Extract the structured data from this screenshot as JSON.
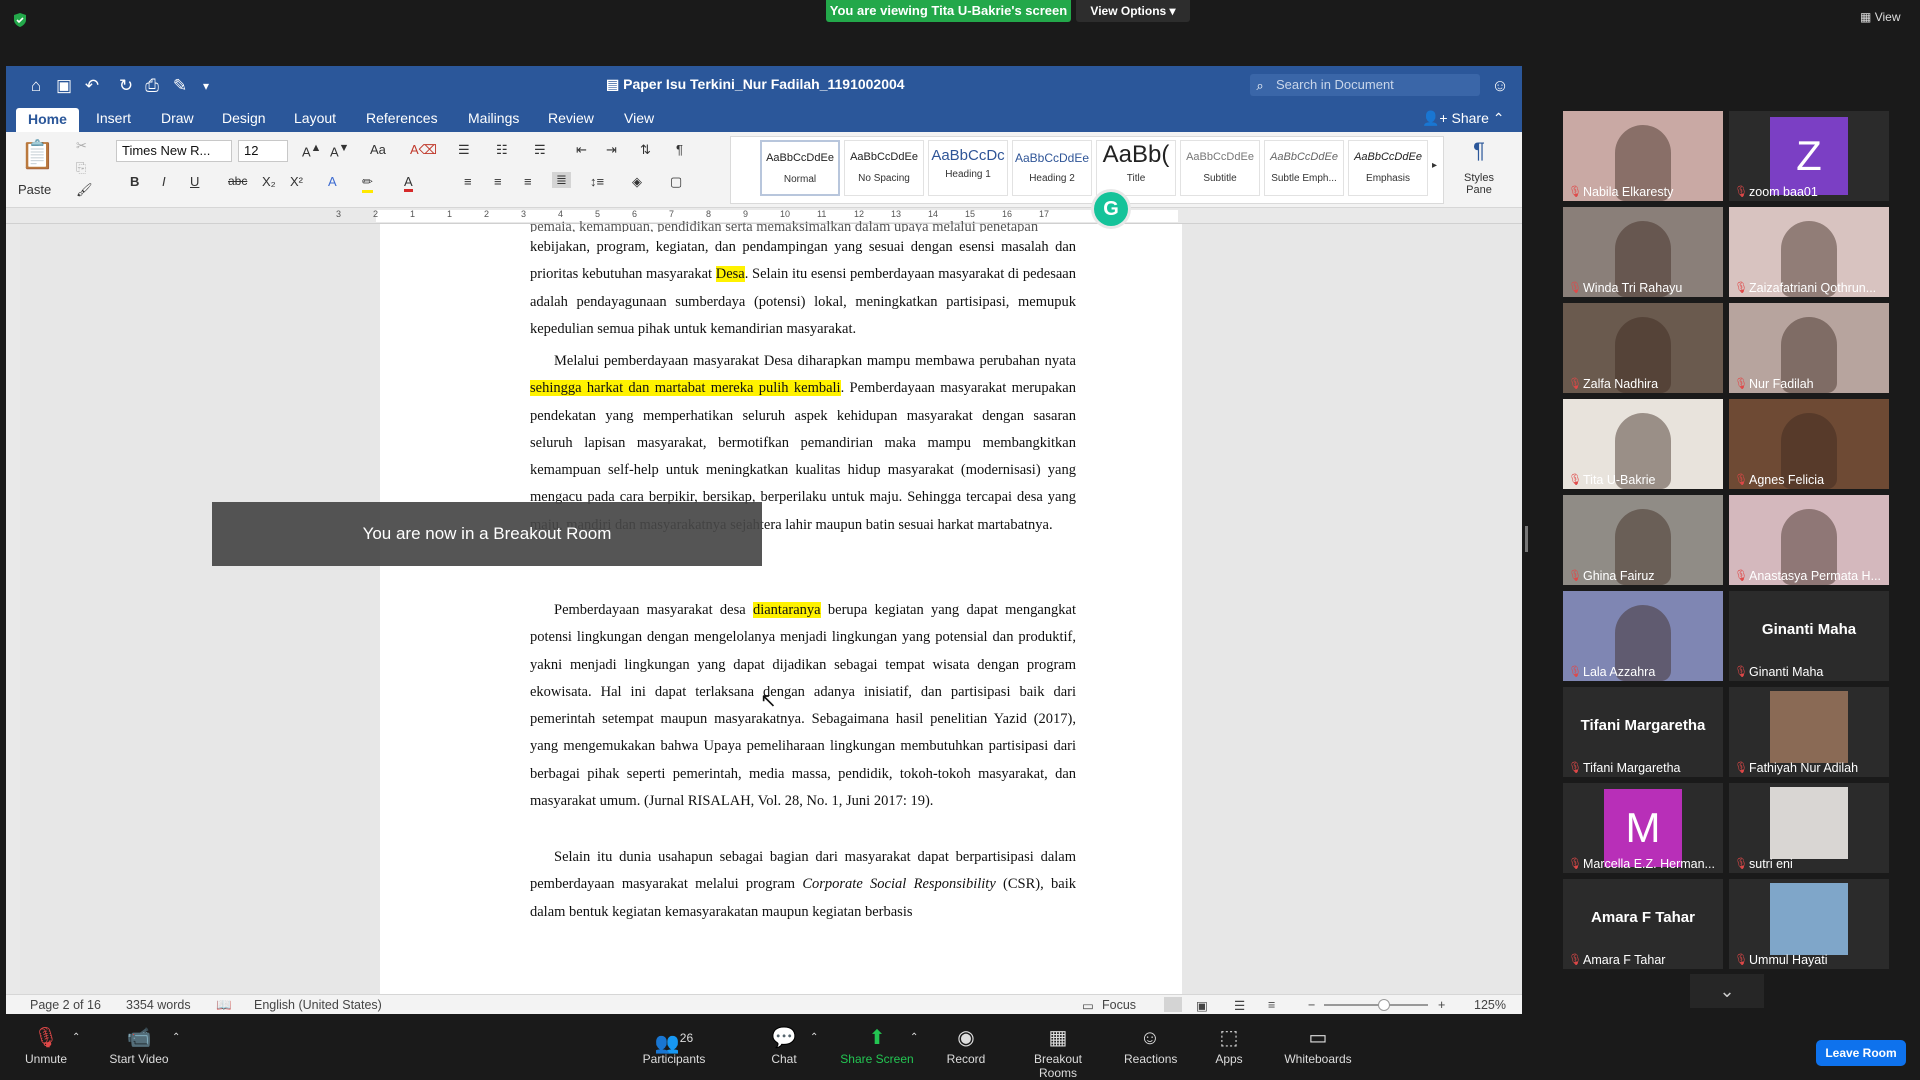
{
  "zoom_top": {
    "banner": "You are viewing Tita U-Bakrie's screen",
    "view_options": "View Options",
    "view": "View"
  },
  "word": {
    "doc_title": "Paper Isu Terkini_Nur Fadilah_1191002004",
    "search_placeholder": "Search in Document",
    "tabs": [
      "Home",
      "Insert",
      "Draw",
      "Design",
      "Layout",
      "References",
      "Mailings",
      "Review",
      "View"
    ],
    "share": "Share",
    "ribbon": {
      "paste": "Paste",
      "font": "Times New R...",
      "size": "12",
      "bold": "B",
      "italic": "I",
      "underline": "U",
      "strike": "abc",
      "sub": "X₂",
      "sup": "X²",
      "styles_pane": "Styles Pane",
      "styles": [
        {
          "sample": "AaBbCcDdEe",
          "name": "Normal"
        },
        {
          "sample": "AaBbCcDdEe",
          "name": "No Spacing"
        },
        {
          "sample": "AaBbCcDc",
          "name": "Heading 1"
        },
        {
          "sample": "AaBbCcDdEe",
          "name": "Heading 2"
        },
        {
          "sample": "AaBb(",
          "name": "Title"
        },
        {
          "sample": "AaBbCcDdEe",
          "name": "Subtitle"
        },
        {
          "sample": "AaBbCcDdEe",
          "name": "Subtle Emph..."
        },
        {
          "sample": "AaBbCcDdEe",
          "name": "Emphasis"
        }
      ]
    },
    "ruler_numbers": [
      "3",
      "2",
      "1",
      "1",
      "2",
      "3",
      "4",
      "5",
      "6",
      "7",
      "8",
      "9",
      "10",
      "11",
      "12",
      "13",
      "14",
      "15",
      "16",
      "17"
    ],
    "doc": {
      "p0_top": "pemaia, kemampuan, pendidikan serta memaksimalkan dalam upaya melalui penetapan",
      "p0": [
        "kebijakan, program, kegiatan, dan  pendampingan yang sesuai dengan esensi masalah",
        "dan prioritas kebutuhan masyarakat ",
        "Desa",
        ". Selain itu esensi pemberdayaan masyarakat di pedesaan adalah pendayagunaan sumberdaya (potensi) lokal, meningkatkan partisipasi, memupuk kepedulian semua pihak untuk kemandirian masyarakat."
      ],
      "p1_a": "Melalui pemberdayaan masyarakat Desa diharapkan mampu membawa perubahan nyata ",
      "p1_hl": "sehingga harkat dan martabat mereka pulih kembali",
      "p1_b": ". Pemberdayaan masyarakat merupakan pendekatan yang memperhatikan seluruh aspek kehidupan masyarakat dengan sasaran seluruh lapisan masyarakat, bermotifkan pemandirian maka mampu membangkitkan kemampuan self-help untuk meningkatkan kualitas hidup masyarakat (modernisasi) yang mengacu pada cara berpikir, bersikap, berperilaku untuk maju. Sehingga tercapai desa yang maju, mandiri dan masyarakatnya sejahtera lahir maupun batin sesuai harkat martabatnya.",
      "p2_a": "Pemberdayaan masyarakat desa ",
      "p2_hl": "diantaranya",
      "p2_b": " berupa kegiatan yang dapat mengangkat potensi lingkungan dengan mengelolanya menjadi lingkungan yang potensial dan produktif, yakni menjadi lingkungan yang dapat dijadikan sebagai tempat wisata dengan program ekowisata. Hal ini dapat terlaksana dengan adanya inisiatif, dan partisipasi baik dari pemerintah setempat maupun masyarakatnya. Sebagaimana hasil penelitian Yazid (2017), yang mengemukakan bahwa Upaya pemeliharaan lingkungan membutuhkan partisipasi dari berbagai pihak seperti pemerintah,  media massa, pendidik, tokoh-tokoh masyarakat, dan masyarakat umum. (Jurnal RISALAH, Vol. 28, No. 1, Juni 2017: 19).",
      "p3_a": "Selain itu dunia usahapun sebagai bagian dari masyarakat dapat berpartisipasi dalam pemberdayaan masyarakat melalui program ",
      "p3_it": "Corporate Social Responsibility",
      "p3_b": " (CSR), baik dalam bentuk kegiatan kemasyarakatan maupun kegiatan berbasis"
    },
    "breakout_overlay": "You are now in a Breakout Room",
    "status": {
      "page": "Page 2 of 16",
      "words": "3354 words",
      "language": "English (United States)",
      "focus": "Focus",
      "zoom": "125%"
    }
  },
  "participants": [
    {
      "name": "Nabila Elkaresty",
      "type": "video",
      "color": "#c9a9a4"
    },
    {
      "name": "zoom baa01",
      "type": "avatar",
      "letter": "Z",
      "color": "#7b3fc4"
    },
    {
      "name": "Winda Tri Rahayu",
      "type": "video",
      "color": "#8a7f79"
    },
    {
      "name": "Zaizafatriani Qothrun...",
      "type": "video",
      "color": "#d8c3c0"
    },
    {
      "name": "Zalfa Nadhira",
      "type": "video",
      "color": "#6a5a4e"
    },
    {
      "name": "Nur Fadilah",
      "type": "video",
      "color": "#b7a49e"
    },
    {
      "name": "Tita U-Bakrie",
      "type": "video",
      "color": "#e8e3dc",
      "active": true
    },
    {
      "name": "Agnes Felicia",
      "type": "video",
      "color": "#6e4a34"
    },
    {
      "name": "Ghina Fairuz",
      "type": "video",
      "color": "#908c86"
    },
    {
      "name": "Anastasya Permata H...",
      "type": "video",
      "color": "#d4b8bd"
    },
    {
      "name": "Lala Azzahra",
      "type": "video",
      "color": "#7f86b3"
    },
    {
      "name": "Ginanti Maha",
      "type": "name",
      "big": "Ginanti Maha"
    },
    {
      "name": "Tifani Margaretha",
      "type": "name",
      "big": "Tifani Margaretha"
    },
    {
      "name": "Fathiyah Nur Adilah",
      "type": "video-small",
      "color": "#8a6a55"
    },
    {
      "name": "Marcella E.Z. Herman...",
      "type": "avatar",
      "letter": "M",
      "color": "#b82fb8"
    },
    {
      "name": "sutri eni",
      "type": "video-small",
      "color": "#d9d6d3"
    },
    {
      "name": "Amara F Tahar",
      "type": "name",
      "big": "Amara F Tahar"
    },
    {
      "name": "Ummul Hayati",
      "type": "video-small",
      "color": "#7fa6c9"
    }
  ],
  "toolbar": {
    "unmute": "Unmute",
    "start_video": "Start Video",
    "participants": "Participants",
    "participants_count": "26",
    "chat": "Chat",
    "share_screen": "Share Screen",
    "record": "Record",
    "breakout_rooms": "Breakout Rooms",
    "reactions": "Reactions",
    "apps": "Apps",
    "whiteboards": "Whiteboards",
    "leave_room": "Leave Room"
  }
}
